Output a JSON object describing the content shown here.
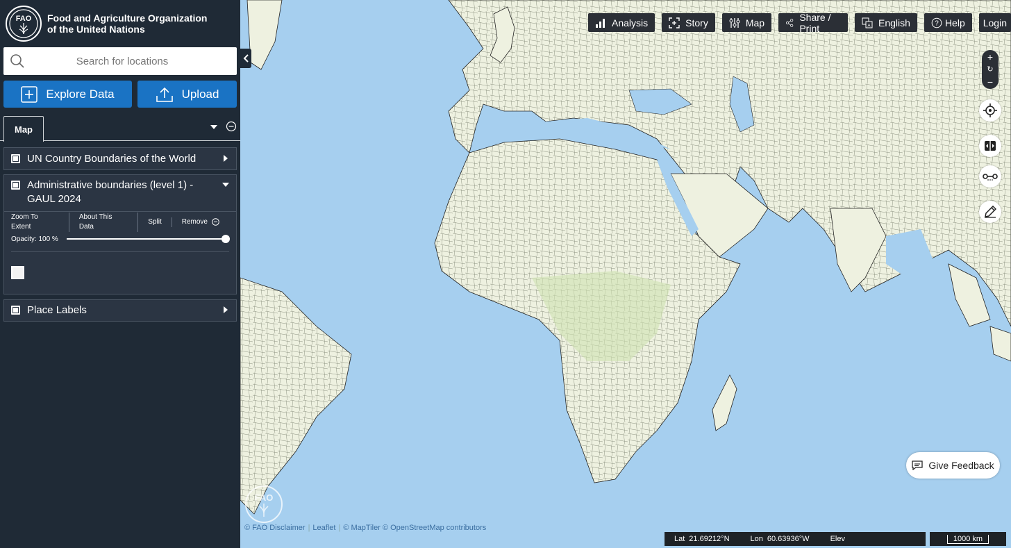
{
  "brand": {
    "line1": "Food and Agriculture Organization",
    "line2": "of the United Nations",
    "logo_letters": "FAO"
  },
  "search": {
    "placeholder": "Search for locations",
    "icon": "search-icon"
  },
  "actions": {
    "explore_label": "Explore Data",
    "upload_label": "Upload"
  },
  "tabs": {
    "active": "Map"
  },
  "layers": [
    {
      "title": "UN Country Boundaries of the World",
      "checked": false,
      "expanded": false
    },
    {
      "title": "Administrative boundaries (level 1) - GAUL 2024",
      "checked": false,
      "expanded": true
    },
    {
      "title": "Place Labels",
      "checked": false,
      "expanded": false
    }
  ],
  "layer_controls": {
    "zoom_to_extent": "Zoom To Extent",
    "about": "About This Data",
    "split": "Split",
    "remove": "Remove",
    "opacity_label": "Opacity: 100 %",
    "opacity": 1.0
  },
  "toolbar": {
    "analysis": "Analysis",
    "story": "Story",
    "map": "Map",
    "share": "Share / Print",
    "language": "English",
    "help": "Help",
    "login": "Login"
  },
  "map_controls": {
    "zoom_in": "+",
    "zoom_reset": "↻",
    "zoom_out": "−"
  },
  "feedback": {
    "label": "Give Feedback"
  },
  "attribution": {
    "disclaimer": "© FAO Disclaimer",
    "leaflet": "Leaflet",
    "tiles": "© MapTiler © OpenStreetMap contributors"
  },
  "coordinates": {
    "lat_label": "Lat",
    "lat_value": "21.69212°N",
    "lon_label": "Lon",
    "lon_value": "60.63936°W",
    "elev_label": "Elev"
  },
  "scale": {
    "label": "1000 km"
  },
  "colors": {
    "sidebar_bg": "#1f2a36",
    "button_blue": "#1a73c4",
    "ocean": "#a6cfef",
    "land": "#eef1e0",
    "toolbar_bg": "#2b2f36"
  }
}
